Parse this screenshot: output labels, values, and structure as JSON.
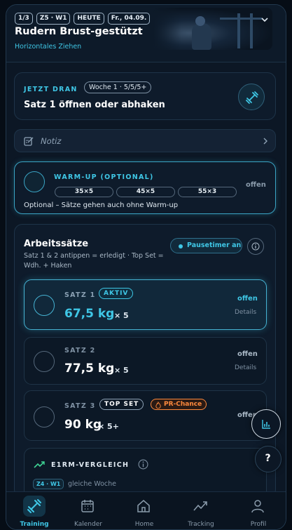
{
  "header": {
    "chips": [
      "1/3",
      "Z5 · W1",
      "HEUTE",
      "Fr., 04.09."
    ],
    "title": "Rudern Brust-gestützt",
    "subtitle": "Horizontales Ziehen"
  },
  "now": {
    "label": "JETZT DRAN",
    "week_chip": "Woche 1 · 5/5/5+",
    "text": "Satz 1 öffnen oder abhaken"
  },
  "note": {
    "label": "Notiz"
  },
  "warmup": {
    "label": "WARM-UP (OPTIONAL)",
    "sets": [
      "35×5",
      "45×5",
      "55×3"
    ],
    "status": "offen",
    "hint": "Optional – Sätze gehen auch ohne Warm-up"
  },
  "work": {
    "title": "Arbeitssätze",
    "hint": "Satz 1 & 2 antippen = erledigt · Top Set = Wdh. + Haken",
    "timer_label": "Pausetimer an",
    "sets": [
      {
        "label": "SATZ 1",
        "badge": "AKTIV",
        "weight": "67,5 kg",
        "reps": "× 5",
        "status": "offen",
        "details": "Details"
      },
      {
        "label": "SATZ 2",
        "weight": "77,5 kg",
        "reps": "× 5",
        "status": "offen",
        "details": "Details"
      },
      {
        "label": "SATZ 3",
        "badge": "TOP SET",
        "pr": "PR-Chance",
        "weight": "90 kg",
        "reps": "× 5+",
        "status": "offen"
      }
    ]
  },
  "e1rm": {
    "label": "E1RM-VERGLEICH",
    "chip": "Z4 · W1",
    "text": "gleiche Woche"
  },
  "help": "?",
  "nav": [
    {
      "label": "Training",
      "icon": "dumbbell-icon"
    },
    {
      "label": "Kalender",
      "icon": "calendar-icon"
    },
    {
      "label": "Home",
      "icon": "home-icon"
    },
    {
      "label": "Tracking",
      "icon": "trend-icon"
    },
    {
      "label": "Profil",
      "icon": "user-icon"
    }
  ],
  "colors": {
    "accent": "#3fc7e6",
    "pr": "#ff8a3d",
    "bg": "#0c1725"
  }
}
